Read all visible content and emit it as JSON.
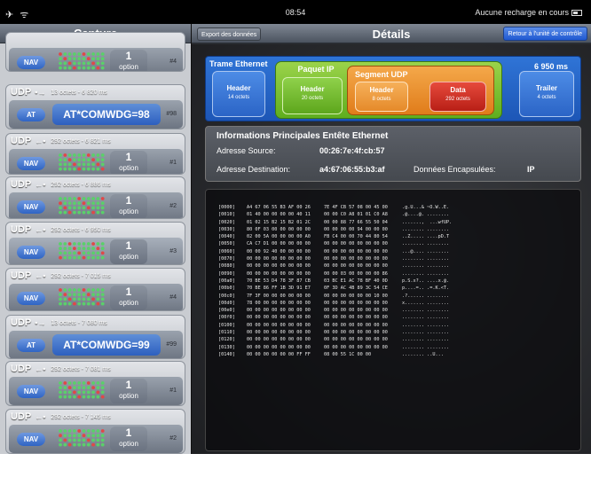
{
  "statusbar": {
    "icons": [
      "airplane-icon",
      "wifi-icon"
    ],
    "time": "08:54",
    "battery_text": "Aucune recharge en cours"
  },
  "left": {
    "title": "Capture",
    "items": [
      {
        "proto": "",
        "meta": "",
        "badge": "NAV",
        "count": "1",
        "option": "option",
        "index": "#4",
        "kind": "nav"
      },
      {
        "proto": "UDP",
        "arrow": "•→",
        "meta": "13 octets - 6 820 ms",
        "badge": "AT",
        "command": "AT*COMWDG=98",
        "index": "#98",
        "kind": "at"
      },
      {
        "proto": "UDP",
        "arrow": "←•",
        "meta": "292 octets - 6 821 ms",
        "badge": "NAV",
        "count": "1",
        "option": "option",
        "index": "#1",
        "kind": "nav"
      },
      {
        "proto": "UDP",
        "arrow": "←•",
        "meta": "292 octets - 6 886 ms",
        "badge": "NAV",
        "count": "1",
        "option": "option",
        "index": "#2",
        "kind": "nav"
      },
      {
        "proto": "UDP",
        "arrow": "←•",
        "meta": "292 octets - 6 950 ms",
        "badge": "NAV",
        "count": "1",
        "option": "option",
        "index": "#3",
        "kind": "nav",
        "selected": true
      },
      {
        "proto": "UDP",
        "arrow": "←•",
        "meta": "292 octets - 7 015 ms",
        "badge": "NAV",
        "count": "1",
        "option": "option",
        "index": "#4",
        "kind": "nav"
      },
      {
        "proto": "UDP",
        "arrow": "•→",
        "meta": "13 octets - 7 080 ms",
        "badge": "AT",
        "command": "AT*COMWDG=99",
        "index": "#99",
        "kind": "at"
      },
      {
        "proto": "UDP",
        "arrow": "←•",
        "meta": "292 octets - 7 081 ms",
        "badge": "NAV",
        "count": "1",
        "option": "option",
        "index": "#1",
        "kind": "nav"
      },
      {
        "proto": "UDP",
        "arrow": "←•",
        "meta": "292 octets - 7 145 ms",
        "badge": "NAV",
        "count": "1",
        "option": "option",
        "index": "#2",
        "kind": "nav"
      }
    ]
  },
  "right": {
    "title": "Détails",
    "export_label": "Export des données",
    "back_label": "Retour à l'unité de contrôle",
    "frame": {
      "title": "Trame Ethernet",
      "time": "6 950 ms",
      "header": {
        "name": "Header",
        "size": "14 octets"
      },
      "trailer": {
        "name": "Trailer",
        "size": "4 octets"
      },
      "ip": {
        "title": "Paquet IP",
        "header": {
          "name": "Header",
          "size": "20 octets"
        }
      },
      "udp": {
        "title": "Segment UDP",
        "header": {
          "name": "Header",
          "size": "8 octets"
        },
        "data": {
          "name": "Data",
          "size": "292 octets"
        }
      }
    },
    "info": {
      "title": "Informations Principales Entête Ethernet",
      "src_label": "Adresse Source:",
      "src_value": "00:26:7e:4f:cb:57",
      "dst_label": "Adresse Destination:",
      "dst_value": "a4:67:06:55:b3:af",
      "enc_label": "Données Encapsulées:",
      "enc_value": "IP"
    },
    "hex": [
      {
        "addr": "[0000]",
        "a": "A4 67 06 55 B3 AF 00 26",
        "b": "7E 4F CB 57 08 00 45 00",
        "ascii": ".g.U...& ~O.W..E."
      },
      {
        "addr": "[0010]",
        "a": "01 40 00 00 00 00 40 11",
        "b": "00 00 C0 A8 01 01 C0 A8",
        "ascii": ".@....@. ........"
      },
      {
        "addr": "[0020]",
        "a": "01 02 15 B2 15 B2 01 2C",
        "b": "00 00 88 77 66 55 50 04",
        "ascii": ".......,  ...wfUP."
      },
      {
        "addr": "[0030]",
        "a": "80 0F 03 00 00 00 00 00",
        "b": "00 00 00 00 94 00 00 00",
        "ascii": "........ ........"
      },
      {
        "addr": "[0040]",
        "a": "02 00 5A 00 00 00 00 A0",
        "b": "FB C4 00 00 70 44 80 54",
        "ascii": "..Z..... ....pD.T"
      },
      {
        "addr": "[0050]",
        "a": "CA C7 D1 00 00 00 00 00",
        "b": "00 00 00 00 00 00 00 00",
        "ascii": "........ ........"
      },
      {
        "addr": "[0060]",
        "a": "00 00 92 40 00 00 00 00",
        "b": "00 00 00 00 00 00 00 00",
        "ascii": "...@.... ........"
      },
      {
        "addr": "[0070]",
        "a": "00 00 00 00 00 00 00 00",
        "b": "00 00 00 00 00 00 00 00",
        "ascii": "........ ........"
      },
      {
        "addr": "[0080]",
        "a": "00 00 00 00 00 00 00 00",
        "b": "00 00 00 00 00 00 00 00",
        "ascii": "........ ........"
      },
      {
        "addr": "[0090]",
        "a": "00 00 00 00 00 00 00 00",
        "b": "00 00 03 00 00 00 00 86",
        "ascii": "........ ........"
      },
      {
        "addr": "[00a0]",
        "a": "70 BE 53 D4 78 3F 87 CB",
        "b": "03 BC E1 AC 78 BF 40 0D",
        "ascii": "p.S.x?.. ....x.@."
      },
      {
        "addr": "[00b0]",
        "a": "70 BE 86 FF 1B 3D 91 E7",
        "b": "0F 3D AC 4B 89 3C 54 CE",
        "ascii": "p....=.. .=.K.<T."
      },
      {
        "addr": "[00c0]",
        "a": "7F 3F 00 00 00 00 00 00",
        "b": "00 00 00 00 00 00 10 00",
        "ascii": ".?...... ........"
      },
      {
        "addr": "[00d0]",
        "a": "78 00 00 00 00 00 00 00",
        "b": "00 00 00 00 00 00 00 00",
        "ascii": "x....... ........"
      },
      {
        "addr": "[00e0]",
        "a": "00 00 00 00 00 00 00 00",
        "b": "00 00 00 00 00 00 00 00",
        "ascii": "........ ........"
      },
      {
        "addr": "[00f0]",
        "a": "00 00 00 00 00 00 00 00",
        "b": "00 00 00 00 00 00 00 00",
        "ascii": "........ ........"
      },
      {
        "addr": "[0100]",
        "a": "00 00 00 00 00 00 00 00",
        "b": "00 00 00 00 00 00 00 00",
        "ascii": "........ ........"
      },
      {
        "addr": "[0110]",
        "a": "00 00 00 00 00 00 00 00",
        "b": "00 00 00 00 00 00 00 00",
        "ascii": "........ ........"
      },
      {
        "addr": "[0120]",
        "a": "00 00 00 00 00 00 00 00",
        "b": "00 00 00 00 00 00 00 00",
        "ascii": "........ ........"
      },
      {
        "addr": "[0130]",
        "a": "00 00 00 00 00 00 00 00",
        "b": "00 00 00 00 00 00 00 00",
        "ascii": "........ ........"
      },
      {
        "addr": "[0140]",
        "a": "00 00 00 00 00 00 FF FF",
        "b": "08 00 55 1C 00 00",
        "ascii": "........ ..U..."
      }
    ]
  },
  "colors": {
    "accent_blue": "#2f64c4",
    "ip_green": "#5fae1e",
    "udp_orange": "#e07c1a",
    "data_red": "#b81f16"
  }
}
